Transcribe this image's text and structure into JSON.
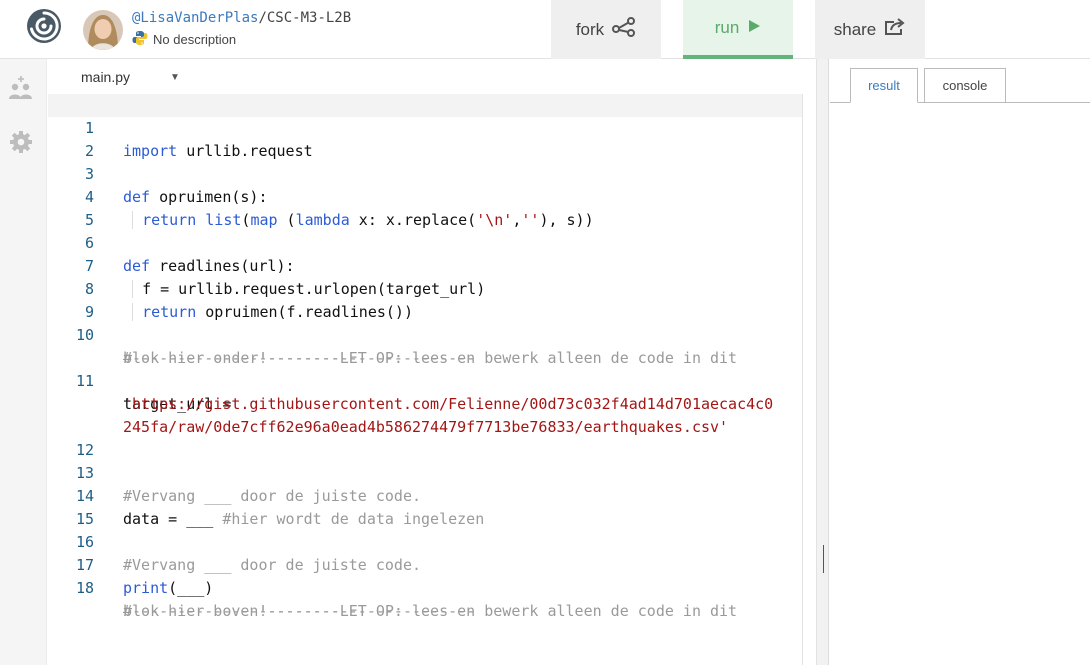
{
  "header": {
    "project_user": "@LisaVanDerPlas",
    "project_sep": "/",
    "project_name": "CSC-M3-L2B",
    "description": "No description",
    "fork_label": "fork",
    "run_label": "run",
    "share_label": "share"
  },
  "editor": {
    "filename": "main.py",
    "lines": [
      {
        "num": "1",
        "text": "import urllib.request"
      },
      {
        "num": "2",
        "text": ""
      },
      {
        "num": "3",
        "text": "def opruimen(s):"
      },
      {
        "num": "4",
        "text": "  return list(map (lambda x: x.replace('\\n',''), s))"
      },
      {
        "num": "5",
        "text": ""
      },
      {
        "num": "6",
        "text": "def readlines(url):"
      },
      {
        "num": "7",
        "text": "  f = urllib.request.urlopen(target_url)"
      },
      {
        "num": "8",
        "text": "  return opruimen(f.readlines())"
      },
      {
        "num": "9",
        "text": ""
      },
      {
        "num": "10",
        "text": "#-----------------------LET OP: lees en bewerk alleen de code in dit",
        "cont": "blok hier onder!-----------------------"
      },
      {
        "num": "11",
        "text": "target_url =",
        "cont": "'https://gist.githubusercontent.com/Felienne/00d73c032f4ad14d701aecac4c0",
        "cont2": "245fa/raw/0de7cff62e96a0ead4b586274479f7713be76833/earthquakes.csv'"
      },
      {
        "num": "12",
        "text": ""
      },
      {
        "num": "13",
        "text": "#Vervang ___ door de juiste code."
      },
      {
        "num": "14",
        "text": "data = ___ #hier wordt de data ingelezen"
      },
      {
        "num": "15",
        "text": ""
      },
      {
        "num": "16",
        "text": "#Vervang ___ door de juiste code."
      },
      {
        "num": "17",
        "text": "print(___)"
      },
      {
        "num": "18",
        "text": "#-----------------------LET OP: lees en bewerk alleen de code in dit",
        "cont": "blok hier boven!-----------------------"
      }
    ]
  },
  "output": {
    "tabs": [
      {
        "label": "result"
      },
      {
        "label": "console"
      }
    ],
    "active_tab": "result"
  },
  "colors": {
    "run_accent": "#63b47a",
    "line_number": "#1d5e87",
    "keyword": "#2b5bd6",
    "string": "#a31515",
    "comment": "#9a9a9a",
    "link": "#3b7bbf"
  },
  "icons": {
    "logo": "trinket-logo-icon",
    "rail": [
      "add-user-icon",
      "gear-icon"
    ],
    "fork": "fork-share-icon",
    "run": "play-icon",
    "share": "share-export-icon",
    "description": "python-icon"
  }
}
